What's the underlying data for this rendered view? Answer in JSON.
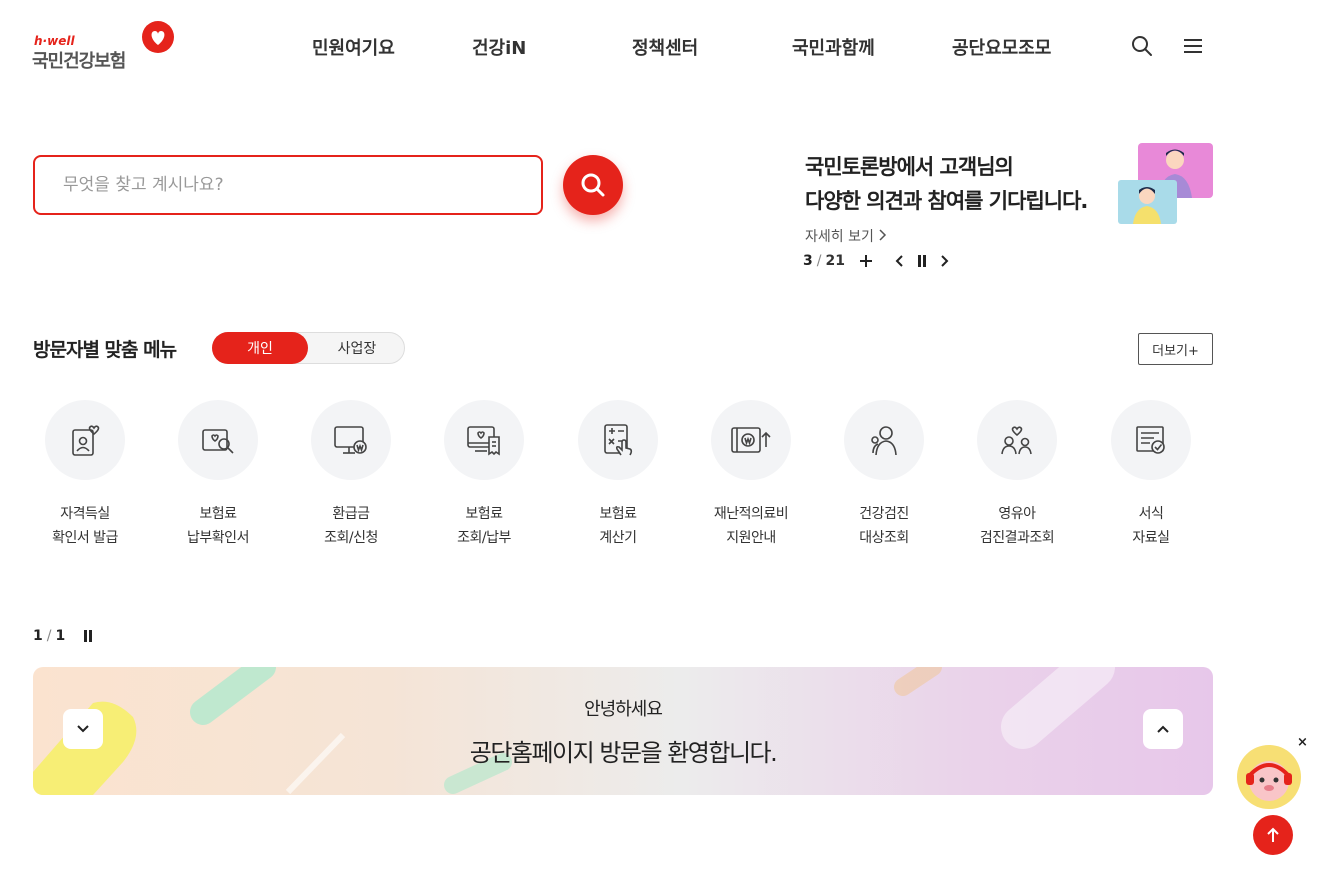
{
  "header": {
    "logo_tag": "h·well",
    "logo_name": "국민건강보험",
    "nav": [
      "민원여기요",
      "건강iN",
      "정책센터",
      "국민과함께",
      "공단요모조모"
    ],
    "icons": [
      "search-icon",
      "menu-icon"
    ]
  },
  "search": {
    "placeholder": "무엇을 찾고 계시나요?",
    "button_icon": "search-icon"
  },
  "promo": {
    "line1": "국민토론방에서 고객님의",
    "line2": "다양한 의견과 참여를 기다립니다.",
    "more": "자세히 보기",
    "current": "3",
    "separator": "/",
    "total": "21"
  },
  "visitor_menu": {
    "title": "방문자별 맞춤 메뉴",
    "tabs": [
      "개인",
      "사업장"
    ],
    "more": "더보기+",
    "items": [
      {
        "line1": "자격득실",
        "line2": "확인서 발급",
        "icon": "id-card-heart-icon"
      },
      {
        "line1": "보험료",
        "line2": "납부확인서",
        "icon": "card-search-icon"
      },
      {
        "line1": "환급금",
        "line2": "조회/신청",
        "icon": "monitor-won-icon"
      },
      {
        "line1": "보험료",
        "line2": "조회/납부",
        "icon": "monitor-receipt-icon"
      },
      {
        "line1": "보험료",
        "line2": "계산기",
        "icon": "calculator-hand-icon"
      },
      {
        "line1": "재난적의료비",
        "line2": "지원안내",
        "icon": "wallet-won-icon"
      },
      {
        "line1": "건강검진",
        "line2": "대상조회",
        "icon": "people-search-icon"
      },
      {
        "line1": "영유아",
        "line2": "검진결과조회",
        "icon": "family-heart-icon"
      },
      {
        "line1": "서식",
        "line2": "자료실",
        "icon": "document-check-icon"
      }
    ],
    "pager_current": "1",
    "pager_separator": "/",
    "pager_total": "1"
  },
  "banner": {
    "sub": "안녕하세요",
    "main": "공단홈페이지 방문을 환영합니다."
  },
  "floating": {
    "close": "×"
  },
  "colors": {
    "brand_red": "#e5231b",
    "icon_bg": "#f3f4f6"
  }
}
